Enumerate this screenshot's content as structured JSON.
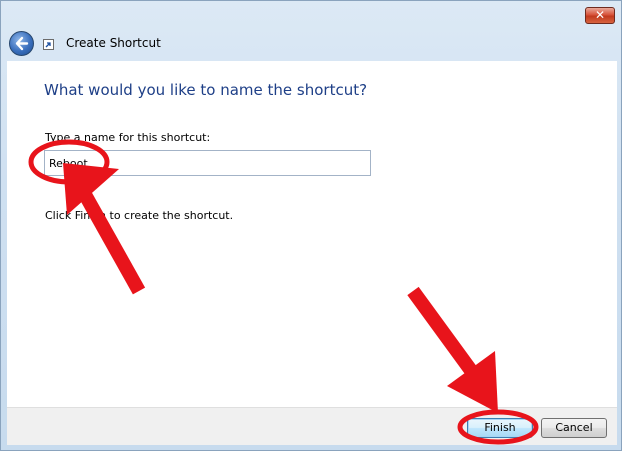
{
  "window": {
    "title": "Create Shortcut",
    "close_label": "✕"
  },
  "page": {
    "heading": "What would you like to name the shortcut?",
    "field_label": "Type a name for this shortcut:",
    "input_value": "Reboot",
    "hint": "Click Finish to create the shortcut."
  },
  "buttons": {
    "finish": "Finish",
    "cancel": "Cancel"
  },
  "icons": {
    "back": "back-arrow-icon",
    "shortcut": "shortcut-arrow-icon",
    "close": "close-icon"
  },
  "colors": {
    "heading": "#1e3f87",
    "annotation": "#e8141b"
  }
}
